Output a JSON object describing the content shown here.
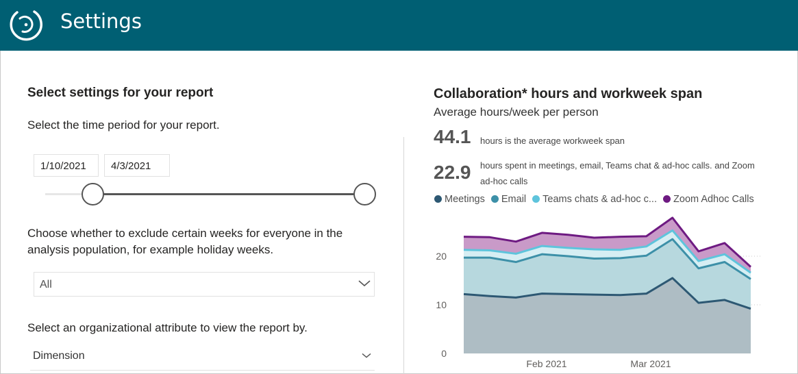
{
  "header": {
    "title": "Settings",
    "logo_icon": "circle-swirl-logo",
    "bg_color": "#005f73"
  },
  "left": {
    "title": "Select settings for your report",
    "time_period_prompt": "Select the time period for your report.",
    "start_date": "1/10/2021",
    "end_date": "4/3/2021",
    "exclude_prompt_line1": "Choose whether to exclude certain weeks for everyone in the",
    "exclude_prompt_line2": "analysis population, for example holiday weeks.",
    "exclude_selected": "All",
    "attribute_prompt": "Select an organizational attribute to view the report by.",
    "dimension_label": "Dimension"
  },
  "right": {
    "title": "Collaboration* hours and workweek span",
    "subtitle": "Average hours/week per person",
    "kpi1_value": "44.1",
    "kpi1_text": "hours is the average workweek span",
    "kpi2_value": "22.9",
    "kpi2_text_line1": "hours spent in meetings, email, Teams chat & ad-hoc calls. and Zoom",
    "kpi2_text_line2": "ad-hoc calls",
    "legend": [
      {
        "label": "Meetings",
        "color": "#2d5873"
      },
      {
        "label": "Email",
        "color": "#3d90a8"
      },
      {
        "label": "Teams chats & ad-hoc c...",
        "color": "#5ec4dc"
      },
      {
        "label": "Zoom Adhoc Calls",
        "color": "#6e1a82"
      }
    ]
  },
  "chart_data": {
    "type": "area",
    "stacked": true,
    "x_labels_shown": [
      "Feb 2021",
      "Mar 2021"
    ],
    "y_ticks": [
      0,
      10,
      20
    ],
    "ylim": [
      0,
      30
    ],
    "grid": "dotted horizontal",
    "legend_position": "top",
    "weeks": 12,
    "series": [
      {
        "name": "Meetings",
        "color": "#2d5873",
        "fill": "#aebdc4",
        "values": [
          12.2,
          11.8,
          11.5,
          12.3,
          12.2,
          12.1,
          12.0,
          12.3,
          15.5,
          10.4,
          11.0,
          9.2
        ]
      },
      {
        "name": "Email",
        "color": "#3d90a8",
        "fill": "#b7d8de",
        "values": [
          7.5,
          7.9,
          7.3,
          8.1,
          7.8,
          7.4,
          7.6,
          7.8,
          8.0,
          7.1,
          7.8,
          6.1
        ]
      },
      {
        "name": "Teams chats & ad-hoc c...",
        "color": "#5ec4dc",
        "fill": "#d6eef3",
        "values": [
          1.6,
          1.5,
          1.7,
          1.7,
          1.7,
          1.9,
          1.7,
          1.9,
          1.8,
          1.5,
          1.6,
          1.3
        ]
      },
      {
        "name": "Zoom Adhoc Calls",
        "color": "#6e1a82",
        "fill": "#c99ac8",
        "values": [
          2.7,
          2.7,
          2.5,
          2.7,
          2.7,
          2.4,
          2.7,
          2.1,
          2.6,
          2.0,
          2.3,
          1.2
        ]
      }
    ]
  }
}
